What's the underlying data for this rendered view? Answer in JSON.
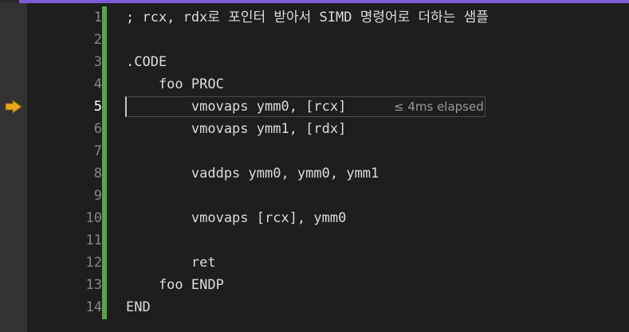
{
  "editor": {
    "current_line": 5,
    "elapsed_label": "≤ 4ms elapsed",
    "lines": [
      {
        "number": "1",
        "text": "; rcx, rdx로 포인터 받아서 SIMD 명령어로 더하는 샘플"
      },
      {
        "number": "2",
        "text": ""
      },
      {
        "number": "3",
        "text": ".CODE"
      },
      {
        "number": "4",
        "text": "    foo PROC"
      },
      {
        "number": "5",
        "text": "        vmovaps ymm0, [rcx]"
      },
      {
        "number": "6",
        "text": "        vmovaps ymm1, [rdx]"
      },
      {
        "number": "7",
        "text": ""
      },
      {
        "number": "8",
        "text": "        vaddps ymm0, ymm0, ymm1"
      },
      {
        "number": "9",
        "text": ""
      },
      {
        "number": "10",
        "text": "        vmovaps [rcx], ymm0"
      },
      {
        "number": "11",
        "text": ""
      },
      {
        "number": "12",
        "text": "        ret"
      },
      {
        "number": "13",
        "text": "    foo ENDP"
      },
      {
        "number": "14",
        "text": "END"
      }
    ]
  },
  "colors": {
    "background": "#1e1e1e",
    "glyph_margin": "#333333",
    "change_bar": "#57a64a",
    "accent": "#7b5bd6",
    "execution_arrow": "#e8a81c"
  },
  "icons": {
    "execution_pointer": "yellow-arrow-right"
  }
}
